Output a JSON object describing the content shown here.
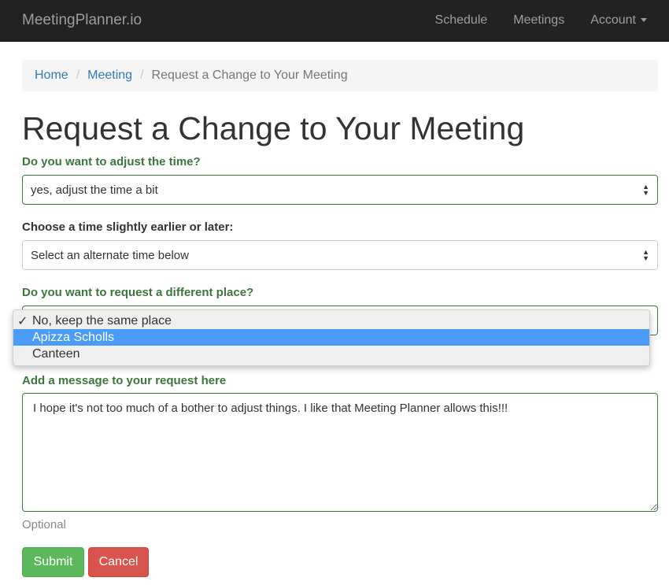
{
  "nav": {
    "brand": "MeetingPlanner.io",
    "items": [
      "Schedule",
      "Meetings",
      "Account"
    ]
  },
  "breadcrumb": [
    "Home",
    "Meeting",
    "Request a Change to Your Meeting"
  ],
  "title": "Request a Change to Your Meeting",
  "time": {
    "label": "Do you want to adjust the time?",
    "value": "yes, adjust the time a bit"
  },
  "alt": {
    "label": "Choose a time slightly earlier or later:",
    "value": "Select an alternate time below"
  },
  "place": {
    "label": "Do you want to request a different place?",
    "options": [
      "No, keep the same place",
      "Apizza Scholls",
      "Canteen"
    ],
    "selected": "No, keep the same place",
    "highlighted": "Apizza Scholls"
  },
  "message": {
    "label": "Add a message to your request here",
    "value": "I hope it's not too much of a bother to adjust things. I like that Meeting Planner allows this!!!",
    "help": "Optional"
  },
  "buttons": {
    "submit": "Submit",
    "cancel": "Cancel"
  },
  "colors": {
    "success": "#5cb85c",
    "danger": "#d9534f",
    "label_green": "#3c763d",
    "highlight": "#4a9cf7"
  }
}
